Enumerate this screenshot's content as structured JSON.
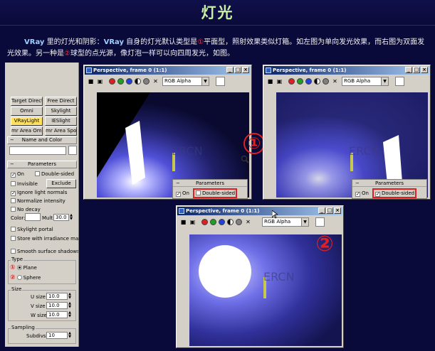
{
  "header": {
    "title": "灯光"
  },
  "intro": {
    "brand": "VRay",
    "part1": " 里的灯光和阴影：",
    "brand2": "VRay",
    "part2": " 自身的灯光默认类型是",
    "circle1": "①",
    "part3": "平面型，照射效果类似灯箱。如左图为单向发光效果，而右图为双面发光效果。另一种是",
    "circle2": "②",
    "part4": "球型的点光源，像灯泡一样可以向四周发光，如图。"
  },
  "panel": {
    "buttons": [
      "Target Direct",
      "Free Direct",
      "Omni",
      "Skylight",
      "VRayLight",
      "IESlight",
      "mr Area Omni",
      "mr Area Spot"
    ],
    "selected_button": "VRayLight",
    "name_rollout": "Name and Color",
    "params_rollout": "Parameters",
    "on_label": "On",
    "double_sided_label": "Double-sided",
    "invisible_label": "Invisible",
    "exclude_label": "Exclude",
    "ignore_normals_label": "Ignore light normals",
    "no_decay_label": "No decay",
    "normalize_label": "Normalize intensity",
    "color_label": "Color:",
    "mult_label": "Mult:",
    "mult_value": "30.0",
    "skylight_portal_label": "Skylight portal",
    "store_irradiance_label": "Store with irradiance map",
    "smooth_shadows_label": "Smooth surface shadows",
    "type_label": "Type",
    "type_num1": "①",
    "type_num2": "②",
    "plane_label": "Plane",
    "sphere_label": "Sphere",
    "size_label": "Size",
    "usize_label": "U size",
    "usize_value": "10.0",
    "vsize_label": "V size",
    "vsize_value": "10.0",
    "wsize_label": "W size",
    "wsize_value": "10.0",
    "sampling_label": "Sampling",
    "subdivs_label": "Subdivs:",
    "subdivs_value": "10"
  },
  "viewports": {
    "title": "Perspective, frame 0 (1:1)",
    "channel": "RGB Alpha",
    "params_title": "Parameters",
    "on_label": "On",
    "double_sided_label": "Double-sided",
    "watermark": "ERCN",
    "num1": "①",
    "num2": "②"
  },
  "colors": {
    "red_dot": "#e02020",
    "green_dot": "#20a020",
    "blue_dot": "#2040e0",
    "title_bar": "#0a246a",
    "highlight": "#e02020"
  }
}
